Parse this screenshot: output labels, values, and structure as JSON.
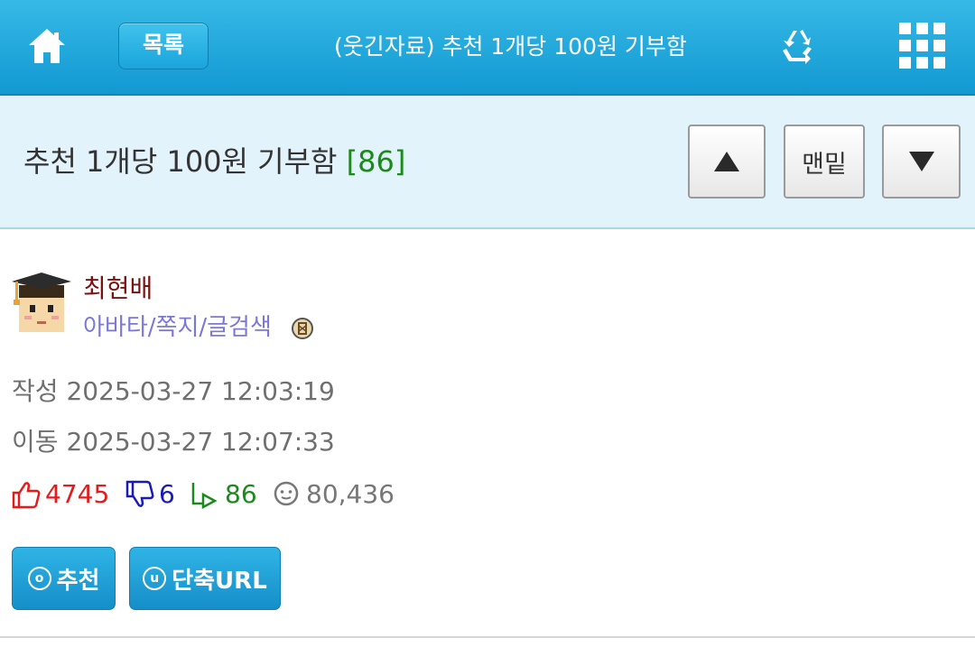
{
  "header": {
    "home_icon": "home-icon",
    "list_label": "목록",
    "title": "(웃긴자료) 추천 1개당 100원 기부함",
    "recycle_icon": "recycle-icon",
    "menu_icon": "grid-menu-icon"
  },
  "post": {
    "title": "추천 1개당 100원 기부함",
    "reply_count": "[86]",
    "nav": {
      "up_icon": "triangle-up-icon",
      "bottom_label": "맨밑",
      "down_icon": "triangle-down-icon"
    }
  },
  "author": {
    "name": "최현배",
    "links": "아바타/쪽지/글검색",
    "avatar_icon": "avatar",
    "badge_icon": "badge-icon"
  },
  "meta": {
    "created_label": "작성",
    "created": "2025-03-27 12:03:19",
    "moved_label": "이동",
    "moved": "2025-03-27 12:07:33"
  },
  "stats": {
    "likes": "4745",
    "dislikes": "6",
    "replies": "86",
    "views": "80,436"
  },
  "actions": {
    "recommend_label": "추천",
    "recommend_letter": "o",
    "shorturl_label": "단축URL",
    "shorturl_letter": "u"
  },
  "colors": {
    "header_bg": "#1ea6dc",
    "title_bg": "#e3f3fb",
    "like": "#e31b1b",
    "dislike": "#1a1ab8",
    "reply": "#1a8a1a",
    "author_name": "#7a1010",
    "author_links": "#7b78d8"
  }
}
